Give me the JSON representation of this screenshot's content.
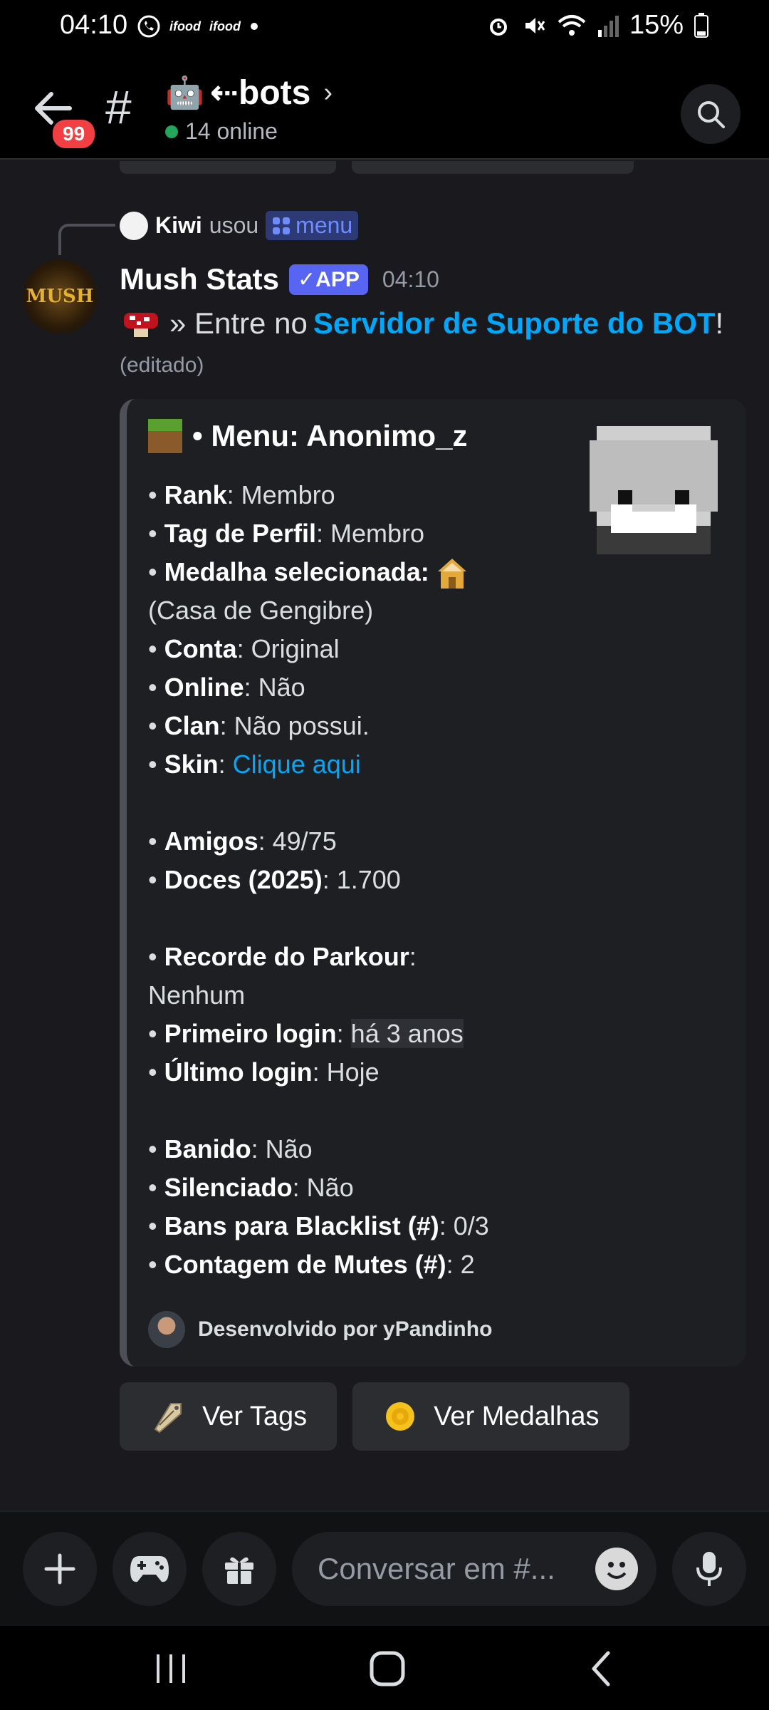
{
  "status_bar": {
    "time": "04:10",
    "notif_labels": [
      "ifood",
      "ifood"
    ],
    "battery": "15%"
  },
  "header": {
    "unread_badge": "99",
    "channel_emoji": "🤖",
    "channel_name": "⇠bots",
    "online_count": "14 online"
  },
  "reply": {
    "user": "Kiwi",
    "action": "usou",
    "command": "menu"
  },
  "message": {
    "author": "Mush Stats",
    "app_tag": "✓APP",
    "timestamp": "04:10",
    "prefix": "» Entre no",
    "link_text": "Servidor de Suporte do BOT",
    "suffix": "!",
    "edited": "(editado)",
    "avatar_text": "MUSH"
  },
  "embed": {
    "title": "• Menu: Anonimo_z",
    "fields": {
      "rank_label": "Rank",
      "rank_value": ": Membro",
      "tag_label": "Tag de Perfil",
      "tag_value": ": Membro",
      "medal_label": "Medalha selecionada",
      "medal_value": "(Casa de Gengibre)",
      "conta_label": "Conta",
      "conta_value": ": Original",
      "online_label": "Online",
      "online_value": ": Não",
      "clan_label": "Clan",
      "clan_value": ": Não possui.",
      "skin_label": "Skin",
      "skin_value": "Clique aqui",
      "amigos_label": "Amigos",
      "amigos_value": ": 49/75",
      "doces_label": "Doces (2025)",
      "doces_value": ": 1.700",
      "parkour_label": "Recorde do Parkour",
      "parkour_value": "Nenhum",
      "primeiro_label": "Primeiro login",
      "primeiro_value": "há 3 anos",
      "ultimo_label": "Último login",
      "ultimo_value": ": Hoje",
      "banido_label": "Banido",
      "banido_value": ": Não",
      "silenciado_label": "Silenciado",
      "silenciado_value": ": Não",
      "bans_label": "Bans para Blacklist (#)",
      "bans_value": ": 0/3",
      "mutes_label": "Contagem de Mutes (#)",
      "mutes_value": ": 2"
    },
    "footer": "Desenvolvido por yPandinho"
  },
  "buttons": {
    "tags": "Ver Tags",
    "medals": "Ver Medalhas"
  },
  "composer": {
    "placeholder": "Conversar em #..."
  },
  "colors": {
    "link": "#00a8fc",
    "app_tag": "#5865f2",
    "online": "#23a55a",
    "badge": "#f23f43"
  }
}
